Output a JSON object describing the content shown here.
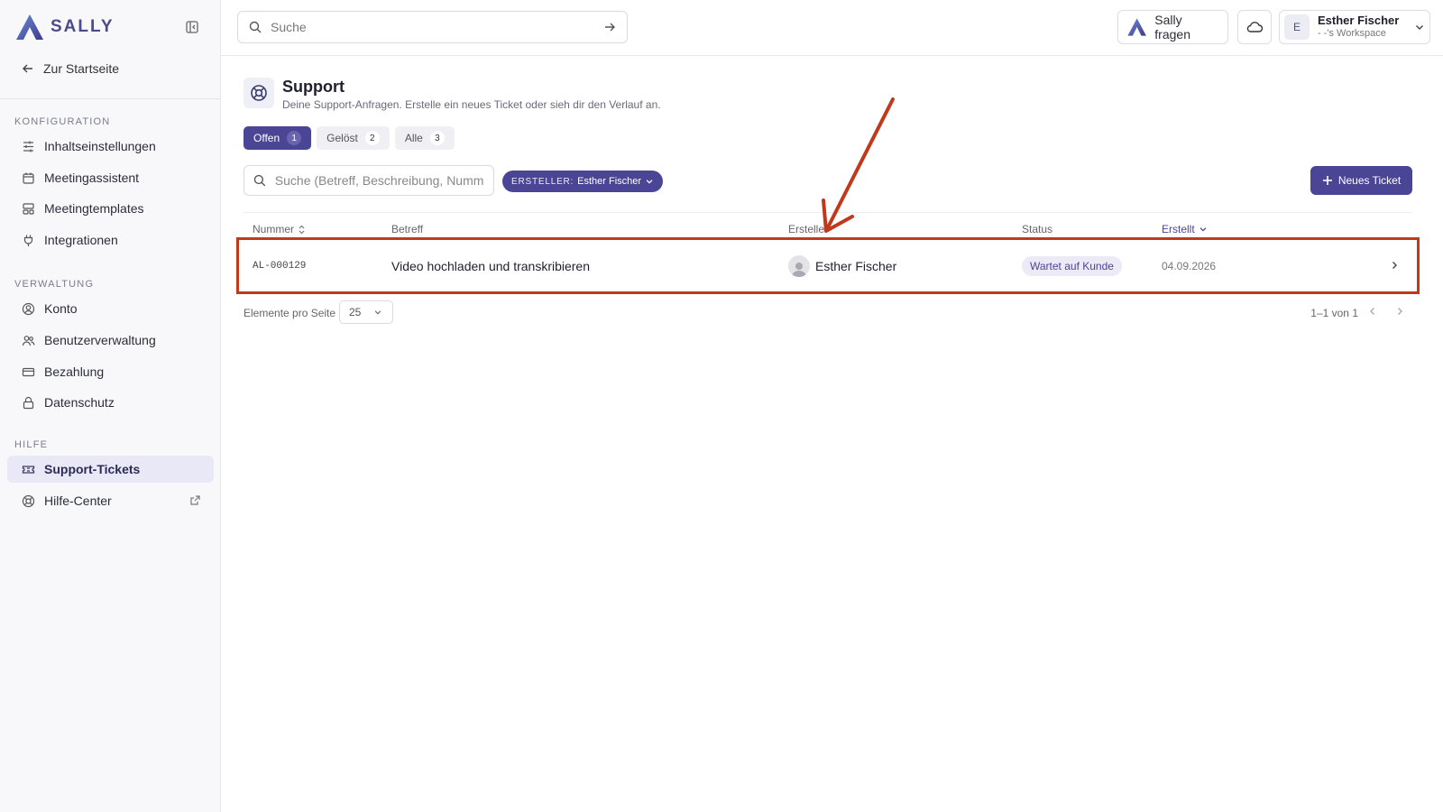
{
  "app": {
    "name": "SALLY"
  },
  "sidebar": {
    "back_label": "Zur Startseite",
    "sections": [
      {
        "title": "KONFIGURATION",
        "items": [
          {
            "label": "Inhaltseinstellungen",
            "icon": "sliders-icon"
          },
          {
            "label": "Meetingassistent",
            "icon": "calendar-icon"
          },
          {
            "label": "Meetingtemplates",
            "icon": "template-icon"
          },
          {
            "label": "Integrationen",
            "icon": "plug-icon"
          }
        ]
      },
      {
        "title": "VERWALTUNG",
        "items": [
          {
            "label": "Konto",
            "icon": "account-icon"
          },
          {
            "label": "Benutzerverwaltung",
            "icon": "users-icon"
          },
          {
            "label": "Bezahlung",
            "icon": "credit-card-icon"
          },
          {
            "label": "Datenschutz",
            "icon": "lock-icon"
          }
        ]
      },
      {
        "title": "HILFE",
        "items": [
          {
            "label": "Support-Tickets",
            "icon": "ticket-icon",
            "active": true
          },
          {
            "label": "Hilfe-Center",
            "icon": "lifebuoy-icon",
            "external": true
          }
        ]
      }
    ]
  },
  "topbar": {
    "search_placeholder": "Suche",
    "ask_label": "Sally fragen",
    "user": {
      "initial": "E",
      "name": "Esther Fischer",
      "workspace": "- -'s Workspace"
    }
  },
  "page": {
    "title": "Support",
    "subtitle": "Deine Support-Anfragen. Erstelle ein neues Ticket oder sieh dir den Verlauf an.",
    "tabs": [
      {
        "label": "Offen",
        "count": "1",
        "active": true
      },
      {
        "label": "Gelöst",
        "count": "2"
      },
      {
        "label": "Alle",
        "count": "3"
      }
    ],
    "filter_placeholder": "Suche (Betreff, Beschreibung, Nummer)",
    "creator_filter": {
      "key": "ERSTELLER:",
      "value": "Esther Fischer"
    },
    "new_ticket_label": "Neues Ticket"
  },
  "table": {
    "columns": {
      "number": "Nummer",
      "subject": "Betreff",
      "creator": "Ersteller",
      "status": "Status",
      "created": "Erstellt"
    },
    "rows": [
      {
        "number": "AL-000129",
        "subject": "Video hochladen und transkribieren",
        "creator": "Esther Fischer",
        "status": "Wartet auf Kunde",
        "created": "04.09.2026"
      }
    ]
  },
  "pagination": {
    "per_page_label": "Elemente pro Seite",
    "per_page_value": "25",
    "range": "1–1 von 1"
  },
  "colors": {
    "accent": "#4b4596",
    "annotation": "#c0391a"
  }
}
